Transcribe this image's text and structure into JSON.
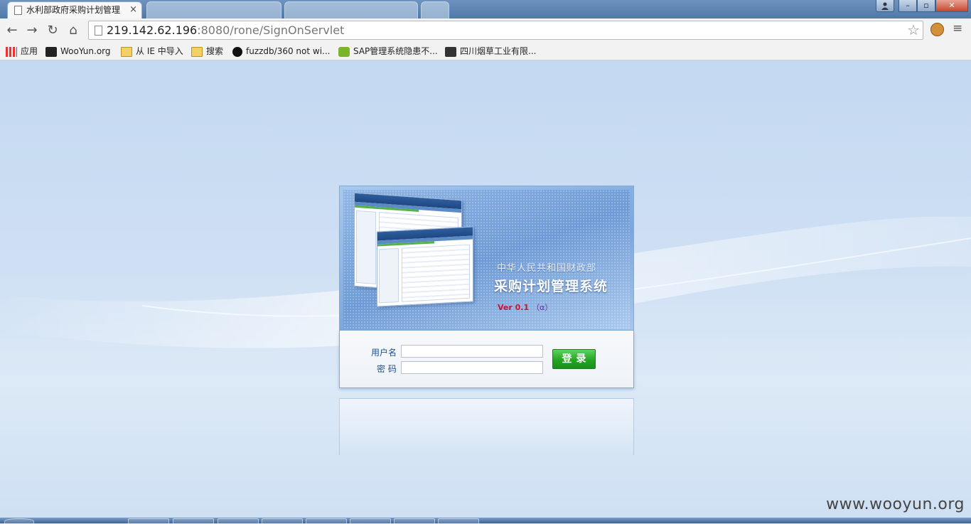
{
  "browser": {
    "active_tab_title": "水利部政府采购计划管理",
    "tab_close_glyph": "×",
    "url_host": "219.142.62.196",
    "url_rest": ":8080/rone/SignOnServlet",
    "window_controls": {
      "minimize": "–",
      "maximize": "▫",
      "close": "✕"
    },
    "nav": {
      "back": "←",
      "forward": "→",
      "reload": "↻",
      "home": "⌂",
      "star": "☆",
      "menu": "≡"
    }
  },
  "bookmarks": [
    {
      "label": "应用",
      "icon": "apps-grid-icon"
    },
    {
      "label": "WooYun.org",
      "icon": "wooyun-icon"
    },
    {
      "label": "从 IE 中导入",
      "icon": "folder-icon"
    },
    {
      "label": "搜索",
      "icon": "folder-icon"
    },
    {
      "label": "fuzzdb/360 not wi...",
      "icon": "github-icon"
    },
    {
      "label": "SAP管理系统隐患不...",
      "icon": "sap-icon"
    },
    {
      "label": "四川烟草工业有限...",
      "icon": "site-icon"
    }
  ],
  "banner": {
    "ministry": "中华人民共和国财政部",
    "system_title": "采购计划管理系统",
    "version": "Ver 0.1",
    "version_alpha": "（α）"
  },
  "login": {
    "username_label": "用户名",
    "password_label": "密 码",
    "username_value": "",
    "password_value": "",
    "submit_label": "登录"
  },
  "watermark": "www.wooyun.org",
  "colors": {
    "page_bg": "#c9dcf2",
    "banner_blue": "#7ba6dd",
    "login_green": "#24a524",
    "version_red": "#c8152b",
    "label_blue": "#1d4f8f"
  }
}
